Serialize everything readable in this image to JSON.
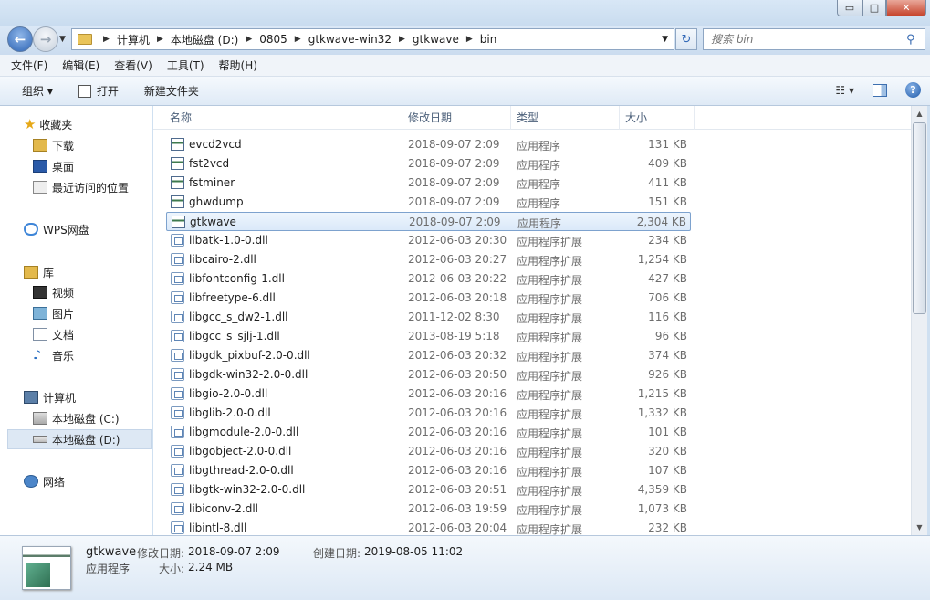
{
  "window": {
    "controls": {
      "min": "▭",
      "max": "□",
      "close": "✕"
    }
  },
  "address": {
    "crumbs": [
      "计算机",
      "本地磁盘 (D:)",
      "0805",
      "gtkwave-win32",
      "gtkwave",
      "bin"
    ],
    "search_placeholder": "搜索 bin"
  },
  "menu": [
    "文件(F)",
    "编辑(E)",
    "查看(V)",
    "工具(T)",
    "帮助(H)"
  ],
  "toolbar": {
    "organize": "组织 ▾",
    "open": "打开",
    "new_folder": "新建文件夹"
  },
  "nav": {
    "favorites": "收藏夹",
    "downloads": "下载",
    "desktop": "桌面",
    "recent": "最近访问的位置",
    "wps": "WPS网盘",
    "libraries": "库",
    "videos": "视频",
    "pictures": "图片",
    "documents": "文档",
    "music": "音乐",
    "computer": "计算机",
    "drive_c": "本地磁盘 (C:)",
    "drive_d": "本地磁盘 (D:)",
    "network": "网络"
  },
  "columns": {
    "name": "名称",
    "date": "修改日期",
    "type": "类型",
    "size": "大小"
  },
  "files": [
    {
      "name": "evcd2vcd",
      "date": "2018-09-07 2:09",
      "type": "应用程序",
      "size": "131 KB"
    },
    {
      "name": "fst2vcd",
      "date": "2018-09-07 2:09",
      "type": "应用程序",
      "size": "409 KB"
    },
    {
      "name": "fstminer",
      "date": "2018-09-07 2:09",
      "type": "应用程序",
      "size": "411 KB"
    },
    {
      "name": "ghwdump",
      "date": "2018-09-07 2:09",
      "type": "应用程序",
      "size": "151 KB"
    },
    {
      "name": "gtkwave",
      "date": "2018-09-07 2:09",
      "type": "应用程序",
      "size": "2,304 KB"
    },
    {
      "name": "libatk-1.0-0.dll",
      "date": "2012-06-03 20:30",
      "type": "应用程序扩展",
      "size": "234 KB"
    },
    {
      "name": "libcairo-2.dll",
      "date": "2012-06-03 20:27",
      "type": "应用程序扩展",
      "size": "1,254 KB"
    },
    {
      "name": "libfontconfig-1.dll",
      "date": "2012-06-03 20:22",
      "type": "应用程序扩展",
      "size": "427 KB"
    },
    {
      "name": "libfreetype-6.dll",
      "date": "2012-06-03 20:18",
      "type": "应用程序扩展",
      "size": "706 KB"
    },
    {
      "name": "libgcc_s_dw2-1.dll",
      "date": "2011-12-02 8:30",
      "type": "应用程序扩展",
      "size": "116 KB"
    },
    {
      "name": "libgcc_s_sjlj-1.dll",
      "date": "2013-08-19 5:18",
      "type": "应用程序扩展",
      "size": "96 KB"
    },
    {
      "name": "libgdk_pixbuf-2.0-0.dll",
      "date": "2012-06-03 20:32",
      "type": "应用程序扩展",
      "size": "374 KB"
    },
    {
      "name": "libgdk-win32-2.0-0.dll",
      "date": "2012-06-03 20:50",
      "type": "应用程序扩展",
      "size": "926 KB"
    },
    {
      "name": "libgio-2.0-0.dll",
      "date": "2012-06-03 20:16",
      "type": "应用程序扩展",
      "size": "1,215 KB"
    },
    {
      "name": "libglib-2.0-0.dll",
      "date": "2012-06-03 20:16",
      "type": "应用程序扩展",
      "size": "1,332 KB"
    },
    {
      "name": "libgmodule-2.0-0.dll",
      "date": "2012-06-03 20:16",
      "type": "应用程序扩展",
      "size": "101 KB"
    },
    {
      "name": "libgobject-2.0-0.dll",
      "date": "2012-06-03 20:16",
      "type": "应用程序扩展",
      "size": "320 KB"
    },
    {
      "name": "libgthread-2.0-0.dll",
      "date": "2012-06-03 20:16",
      "type": "应用程序扩展",
      "size": "107 KB"
    },
    {
      "name": "libgtk-win32-2.0-0.dll",
      "date": "2012-06-03 20:51",
      "type": "应用程序扩展",
      "size": "4,359 KB"
    },
    {
      "name": "libiconv-2.dll",
      "date": "2012-06-03 19:59",
      "type": "应用程序扩展",
      "size": "1,073 KB"
    },
    {
      "name": "libintl-8.dll",
      "date": "2012-06-03 20:04",
      "type": "应用程序扩展",
      "size": "232 KB"
    }
  ],
  "details": {
    "name": "gtkwave",
    "type": "应用程序",
    "modified_label": "修改日期:",
    "modified_value": "2018-09-07 2:09",
    "created_label": "创建日期:",
    "created_value": "2019-08-05 11:02",
    "size_label": "大小:",
    "size_value": "2.24 MB"
  }
}
